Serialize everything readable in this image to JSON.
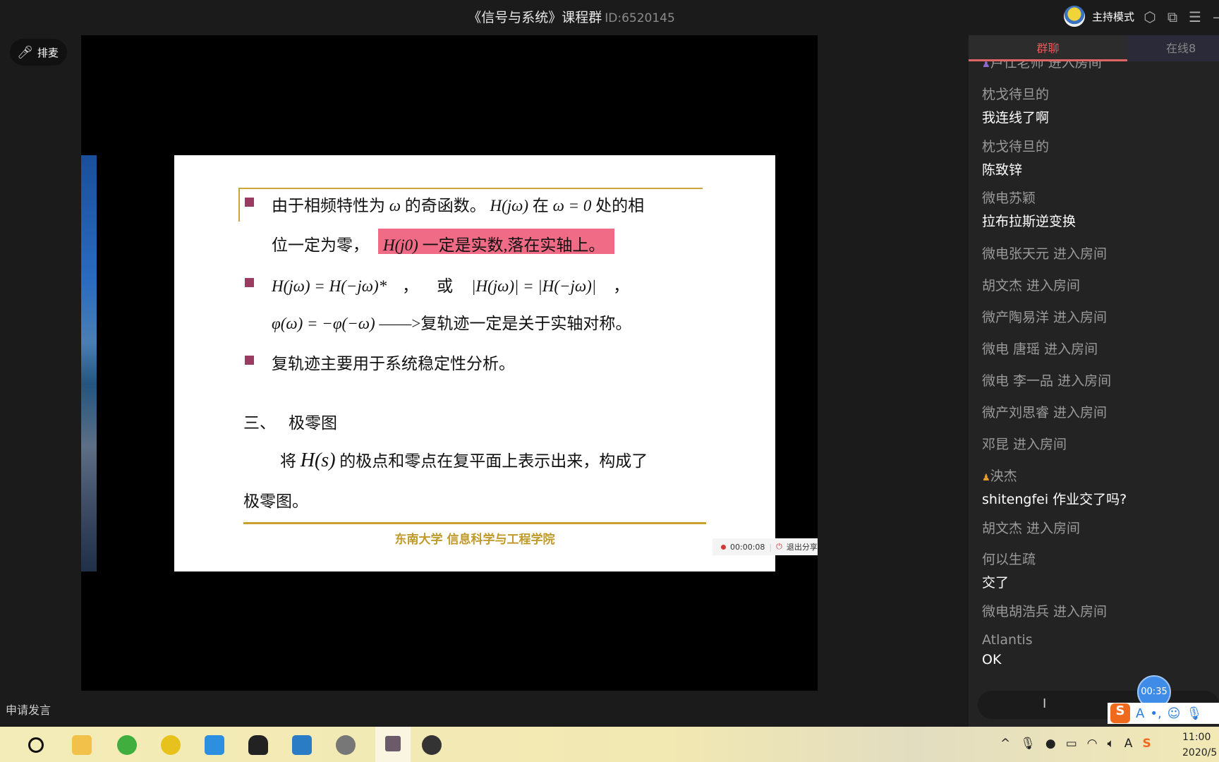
{
  "window": {
    "title": "《信号与系统》课程群",
    "room_id": "ID:6520145",
    "host_mode": "主持模式"
  },
  "left": {
    "queue_button": "排麦",
    "request_speak": "申请发言"
  },
  "slide": {
    "line1": {
      "pre": "由于相频特性为",
      "w": "ω",
      "mid": "的奇函数。",
      "hjw": "H(jω)",
      "at": "在",
      "eq": "ω = 0",
      "post": "处的相"
    },
    "line2": {
      "pre": "位一定为零，",
      "h0": "H(j0)",
      "hl": "一定是实数,落在实轴上",
      "end": "。"
    },
    "line3": {
      "lhs": "H(jω) = H(−jω)*",
      "comma": "，",
      "or": "或",
      "rhs": "|H(jω)| = |H(−jω)|",
      "comma2": "，"
    },
    "line4": {
      "phi": "φ(ω) = −φ(−ω)",
      "arrow": "——>",
      "text": "复轨迹一定是关于实轴对称。"
    },
    "line5": "复轨迹主要用于系统稳定性分析。",
    "section": {
      "num": "三、",
      "title": "极零图"
    },
    "para1": {
      "pre": "将",
      "hs": "H(s)",
      "post": "的极点和零点在复平面上表示出来，构成了"
    },
    "para2": "极零图。",
    "footer": "东南大学  信息科学与工程学院"
  },
  "recording": {
    "time": "00:00:08",
    "stop_label": "退出分享"
  },
  "panel": {
    "tabs": [
      {
        "label": "群聊",
        "active": true
      },
      {
        "label": "在线8"
      }
    ],
    "messages": [
      {
        "name": "卢仕老师 进入房间",
        "text": "",
        "badge": "purple"
      },
      {
        "name": "枕戈待旦的",
        "text": "我连线了啊"
      },
      {
        "name": "枕戈待旦的",
        "text": "陈致锌"
      },
      {
        "name": "微电苏颖",
        "text": "拉布拉斯逆变换"
      },
      {
        "name": "微电张天元 进入房间",
        "text": ""
      },
      {
        "name": "胡文杰 进入房间",
        "text": ""
      },
      {
        "name": "微产陶易洋 进入房间",
        "text": ""
      },
      {
        "name": "微电 唐瑶 进入房间",
        "text": ""
      },
      {
        "name": "微电 李一品 进入房间",
        "text": ""
      },
      {
        "name": "微产刘思睿 进入房间",
        "text": ""
      },
      {
        "name": "邓昆 进入房间",
        "text": ""
      },
      {
        "name": "泱杰",
        "text": "shitengfei 作业交了吗?",
        "badge": "orange"
      },
      {
        "name": "胡文杰 进入房间",
        "text": ""
      },
      {
        "name": "何以生疏",
        "text": "交了"
      },
      {
        "name": "微电胡浩兵 进入房间",
        "text": ""
      },
      {
        "name": "Atlantis",
        "text": "OK"
      }
    ],
    "timer": "00:35"
  },
  "taskbar": {
    "time": "11:00",
    "date": "2020/5"
  },
  "colors": {
    "accent": "#e35a5a",
    "slide_gold": "#c9a53a",
    "highlight": "#f06b86",
    "bullet": "#9b3b62"
  }
}
